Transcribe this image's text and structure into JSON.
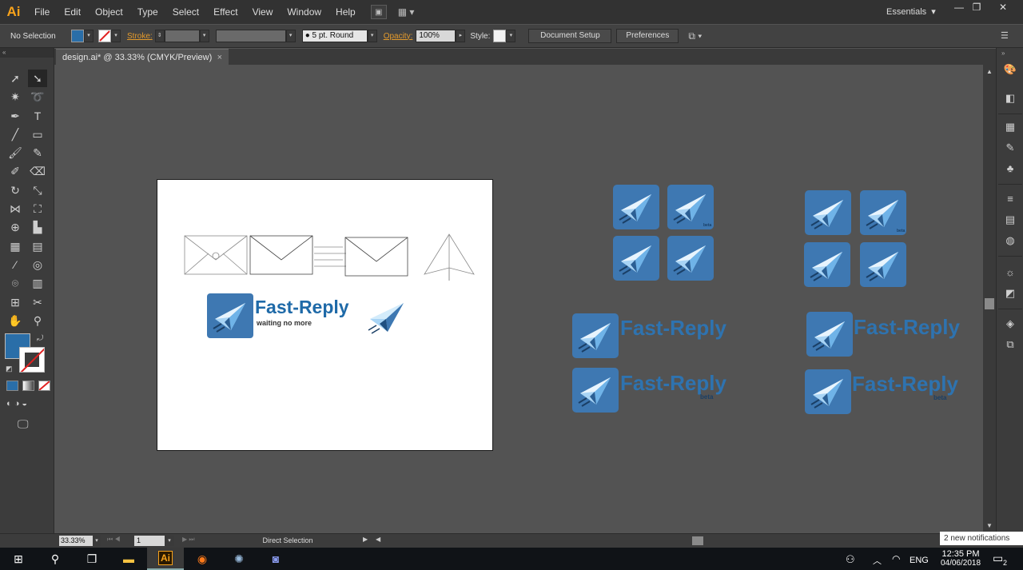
{
  "app": {
    "logo": "Ai",
    "menu": [
      "File",
      "Edit",
      "Object",
      "Type",
      "Select",
      "Effect",
      "View",
      "Window",
      "Help"
    ],
    "workspace": "Essentials"
  },
  "control": {
    "selection_label": "No Selection",
    "stroke_label": "Stroke:",
    "brush_value": "5 pt. Round",
    "opacity_label": "Opacity:",
    "opacity_value": "100%",
    "style_label": "Style:",
    "document_setup": "Document Setup",
    "preferences": "Preferences"
  },
  "document": {
    "tab_title": "design.ai* @ 33.33% (CMYK/Preview)",
    "close_glyph": "×"
  },
  "artwork": {
    "brand": "Fast-Reply",
    "tagline": "waiting no more",
    "beta": "beta"
  },
  "status": {
    "zoom": "33.33%",
    "artboard_num": "1",
    "tool_name": "Direct Selection"
  },
  "taskbar": {
    "language": "ENG",
    "time": "12:35 PM",
    "date": "04/06/2018",
    "notification_text": "2 new notifications",
    "notif_count": "2"
  },
  "colors": {
    "fill": "#2a6ea8",
    "accent_orange": "#f7a21b",
    "logo_blue": "#1f6aa8",
    "icon_bg": "#3e78b2"
  }
}
